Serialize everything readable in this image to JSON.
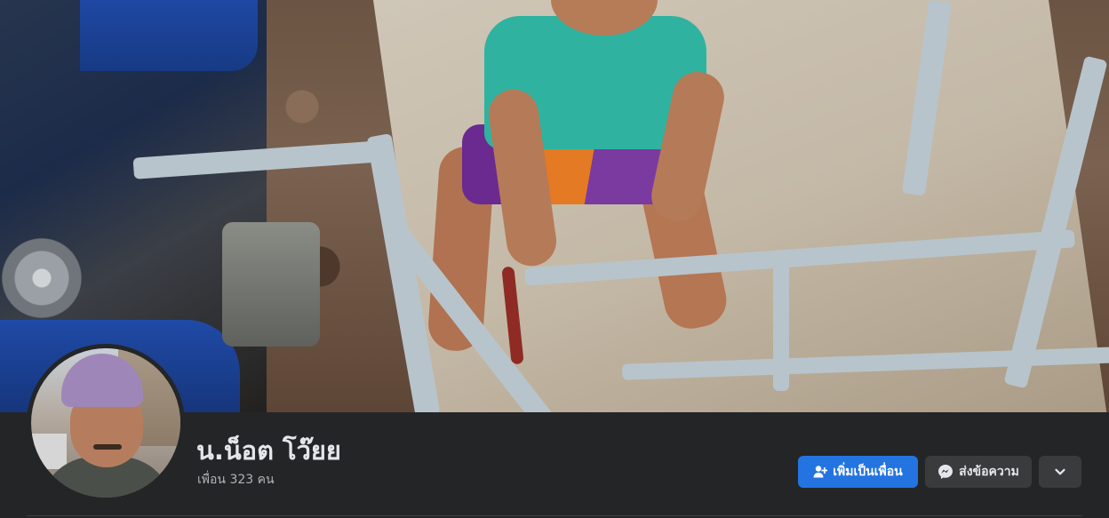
{
  "profile": {
    "name": "น.น็อต โว๊ยย",
    "friends_label": "เพื่อน 323 คน"
  },
  "actions": {
    "add_friend_label": "เพิ่มเป็นเพื่อน",
    "message_label": "ส่งข้อความ",
    "more_icon": "chevron-down-icon"
  },
  "colors": {
    "primary_button": "#2374e1",
    "secondary_button": "#3a3b3c",
    "background": "#242526",
    "text_primary": "#e4e6eb",
    "text_secondary": "#b0b3b8"
  }
}
